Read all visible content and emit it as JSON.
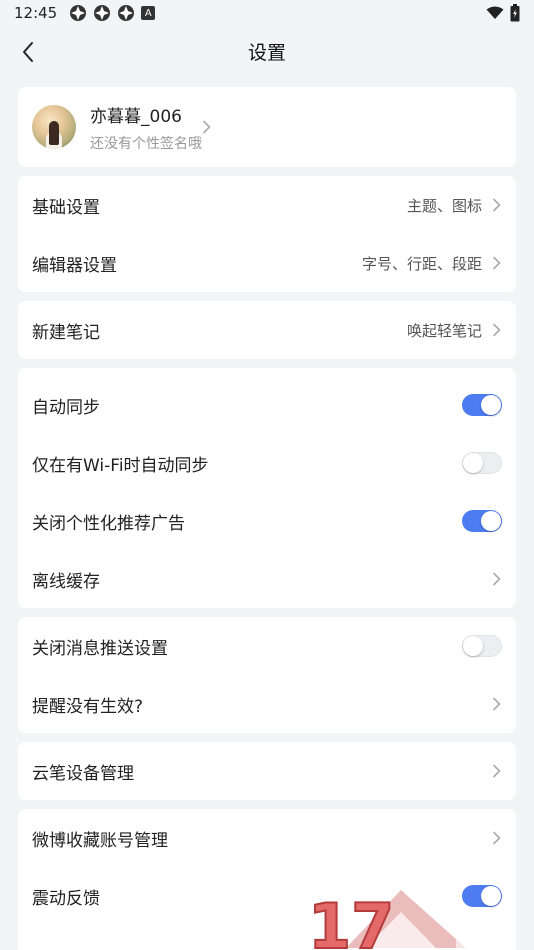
{
  "status_bar": {
    "time": "12:45",
    "badge_letter": "A"
  },
  "nav": {
    "title": "设置"
  },
  "profile": {
    "name": "亦暮暮_006",
    "signature": "还没有个性签名哦"
  },
  "groups": {
    "basic": {
      "label": "基础设置",
      "value": "主题、图标"
    },
    "editor": {
      "label": "编辑器设置",
      "value": "字号、行距、段距"
    },
    "new_note": {
      "label": "新建笔记",
      "value": "唤起轻笔记"
    },
    "auto_sync": {
      "label": "自动同步",
      "on": true
    },
    "wifi_sync": {
      "label": "仅在有Wi-Fi时自动同步",
      "on": false
    },
    "ads": {
      "label": "关闭个性化推荐广告",
      "on": true
    },
    "offline": {
      "label": "离线缓存"
    },
    "push": {
      "label": "关闭消息推送设置",
      "on": false
    },
    "reminder": {
      "label": "提醒没有生效?"
    },
    "pen": {
      "label": "云笔设备管理"
    },
    "weibo": {
      "label": "微博收藏账号管理"
    },
    "vibrate": {
      "label": "震动反馈",
      "on": true
    }
  },
  "watermark": {
    "text": "17"
  },
  "colors": {
    "accent": "#4c7cf0",
    "background": "#f3f4f6",
    "card": "#ffffff",
    "secondary_text": "#999999"
  }
}
